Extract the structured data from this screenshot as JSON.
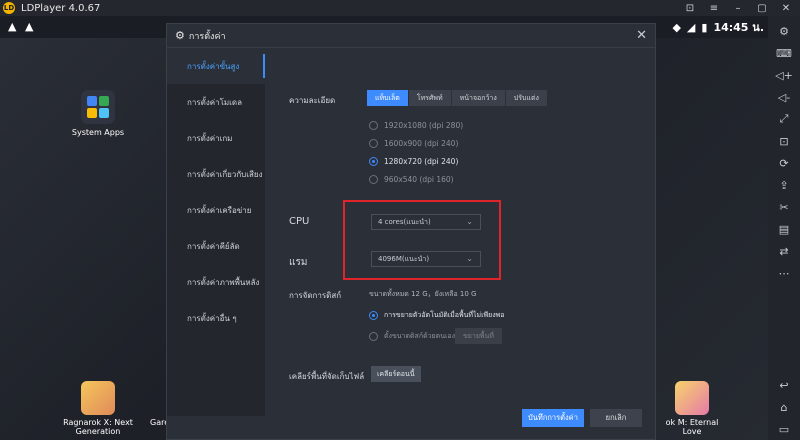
{
  "app": {
    "title": "LDPlayer 4.0.67"
  },
  "status": {
    "time": "14:45",
    "time_suffix": "น."
  },
  "desktop": {
    "system_apps": "System Apps",
    "ragnarok_line1": "Ragnarok X: Next",
    "ragnarok_line2": "Generation",
    "garena_partial": "Gare",
    "eternal_love": "ok M: Eternal Love"
  },
  "dialog": {
    "title": "การตั้งค่า",
    "sidebar": [
      "การตั้งค่าขั้นสูง",
      "การตั้งค่าโมเดล",
      "การตั้งค่าเกม",
      "การตั้งค่าเกี่ยวกับเสียง",
      "การตั้งค่าเครือข่าย",
      "การตั้งค่าคีย์ลัด",
      "การตั้งค่าภาพพื้นหลัง",
      "การตั้งค่าอื่น ๆ"
    ],
    "resolution_label": "ความละเอียด",
    "resolution_tabs": [
      "แท็บเล็ต",
      "โทรศัพท์",
      "หน้าจอกว้าง",
      "ปรับแต่ง"
    ],
    "resolution_options": [
      "1920x1080 (dpi 280)",
      "1600x900 (dpi 240)",
      "1280x720 (dpi 240)",
      "960x540 (dpi 160)"
    ],
    "selected_resolution_index": 2,
    "cpu_label": "CPU",
    "cpu_value": "4 cores(แนะนำ)",
    "ram_label": "แรม",
    "ram_value": "4096M(แนะนำ)",
    "disk_label": "การจัดการดิสก์",
    "disk_info": "ขนาดทั้งหมด 12 G，ยังเหลือ 10 G",
    "disk_option_auto": "การขยายตัวอัตโนมัติเมื่อพื้นที่ไม่เพียงพอ",
    "disk_option_manual": "ตั้งขนาดดิสก์ด้วยตนเอง",
    "disk_expand_button": "ขยายพื้นที่",
    "cache_label": "เคลียร์พื้นที่จัดเก็บไฟล์",
    "cache_button": "เคลียร์ตอนนี้",
    "save_button": "บันทึกการตั้งค่า",
    "cancel_button": "ยกเลิก"
  },
  "colors": {
    "accent": "#3d8bfd",
    "highlight_box": "#e0242c"
  },
  "icons": {
    "toolbar": [
      "gear-icon",
      "keyboard-icon",
      "volume-up-icon",
      "volume-down-icon",
      "fullscreen-icon",
      "screenshot-icon",
      "rotate-icon",
      "install-apk-icon",
      "scissors-icon",
      "shared-folder-icon",
      "sync-icon",
      "more-icon",
      "back-icon",
      "home-icon",
      "recent-apps-icon"
    ]
  }
}
